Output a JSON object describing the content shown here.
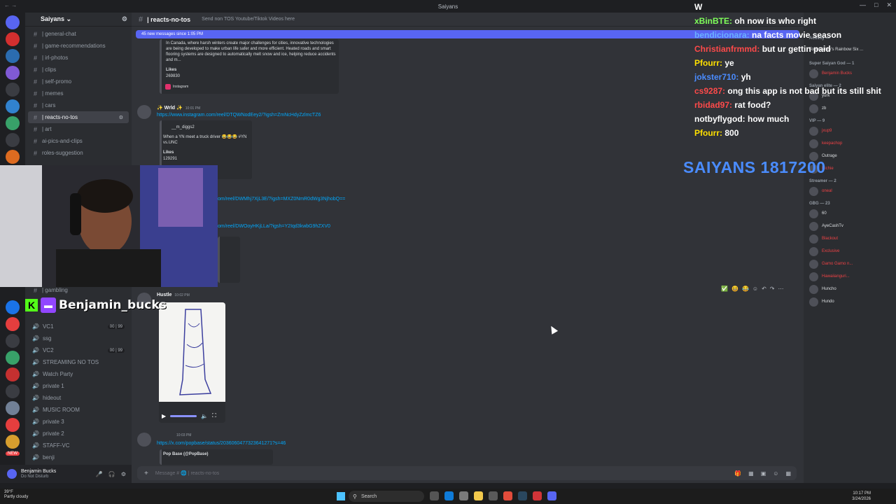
{
  "window": {
    "title": "Saiyans",
    "left": "← →"
  },
  "guild": {
    "name": "Saiyans ⌄"
  },
  "channels": [
    {
      "label": "| general-chat"
    },
    {
      "label": "| game-recommendations"
    },
    {
      "label": "| irl-photos"
    },
    {
      "label": "| clips"
    },
    {
      "label": "| self-promo"
    },
    {
      "label": "| memes"
    },
    {
      "label": "| cars"
    },
    {
      "label": "| reacts-no-tos",
      "active": true
    },
    {
      "label": "| art"
    },
    {
      "label": "ai-pics-and-clips"
    },
    {
      "label": "roles-suggestion"
    }
  ],
  "channels_lower": {
    "gambling": "| gambling"
  },
  "voice": [
    {
      "label": "VC1",
      "count": "00 | 99"
    },
    {
      "label": "ssg"
    },
    {
      "label": "VC2",
      "count": "00 | 99"
    },
    {
      "label": "STREAMING NO TOS"
    },
    {
      "label": "Watch Party"
    },
    {
      "label": "private 1"
    },
    {
      "label": "hideout"
    },
    {
      "label": "MUSIC ROOM"
    },
    {
      "label": "private 3"
    },
    {
      "label": "private 2"
    },
    {
      "label": "STAFF-VC"
    },
    {
      "label": "benji"
    }
  ],
  "user": {
    "name": "Benjamin Bucks",
    "status": "Do Not Disturb",
    "new_badge": "NEW"
  },
  "header": {
    "channel": "| reacts-no-tos",
    "topic": "Send non TOS Youtube/Tiktok Videos here"
  },
  "newbar": "45 new messages since 1:05 PM",
  "embed1": {
    "text": "In Canada, where harsh winters create major challenges for cities, innovative technologies are being developed to make urban life safer and more efficient. Heated roads and smart flooring systems are designed to automatically melt snow and ice, helping reduce accidents and m...",
    "likes_label": "Likes",
    "likes": "269830",
    "source": "Instagram"
  },
  "msg2": {
    "author": "✨ Wrld ✨",
    "time": "10:01 PM",
    "link": "https://www.instagram.com/reel/DTQWNodEey2/?igsh=ZmNcHdyZzlmcTZ6",
    "embed_author": "__m_diggs2",
    "embed_text": "When a YN meet a truck driver 😂😂😂 #YN vs.UNC",
    "likes_label": "Likes",
    "likes": "129291"
  },
  "links": {
    "l1": "om/reel/DWMhj7XjL3E/?igsh=MXZ0NmR0dWg3NjhobQ==",
    "l2": "om/reel/DWOoyHKjLLa/?igsh=Y2Iqd3kwbG9hZXV0"
  },
  "msg3": {
    "author": "Hustle",
    "time": "10:02 PM"
  },
  "msg4": {
    "time": "10:03 PM",
    "link": "https://x.com/popbase/status/2036060477323641271?s=46",
    "embed_author": "Pop Base (@PopBase)"
  },
  "composer": {
    "placeholder": "Message # 🌐 | reacts-no-tos"
  },
  "members": {
    "activity": "Activity —",
    "game": "Tom Clancy's Rainbow Six ...",
    "group1": "Super Saiyan God — 1",
    "member1": "Benjamin Bucks",
    "group2": "Saiyan elite — 2",
    "m_yurk": "yurk",
    "m_zb": "zb",
    "group3": "VIP — 9",
    "m_jxup": "jxup9",
    "m_keep": "keepachop",
    "m_outrage": "Outrage",
    "m_richie": "Richie",
    "group4": "Streamer — 2",
    "m_oneal": "oneal",
    "group5": "GBG — 23",
    "m_60": "60",
    "m_ayecash": "AyeCashTv",
    "m_blackout": "Blackout",
    "m_exclusive": "Exclusive",
    "m_gamo": "Gamo Gamo n...",
    "m_hawaiian": "Hawaiianguri...",
    "m_huncho": "Huncho",
    "m_hundo": "Hundo"
  },
  "overlay_chat": [
    {
      "user": "W",
      "color": "#ffffff",
      "msg": ""
    },
    {
      "user": "xBinBTE:",
      "color": "#7fff5a",
      "msg": "oh now its who right"
    },
    {
      "user": "bendicionara:",
      "color": "#6ab0ff",
      "msg": "na facts movie season"
    },
    {
      "user": "Christianfrmmd:",
      "color": "#ff4a4a",
      "msg": "but ur gettin paid"
    },
    {
      "user": "Pfourr:",
      "color": "#ffe000",
      "msg": "ye"
    },
    {
      "user": "jokster710:",
      "color": "#4a8cff",
      "msg": "yh"
    },
    {
      "user": "cs9287:",
      "color": "#ff4a4a",
      "msg": "ong this app is not bad but its still shit"
    },
    {
      "user": "rbidad97:",
      "color": "#ff4a4a",
      "msg": "rat food?"
    },
    {
      "user": "notbyflygod:",
      "color": "#ffffff",
      "msg": "how much"
    },
    {
      "user": "Pfourr:",
      "color": "#ffe000",
      "msg": "800"
    }
  ],
  "saiyans_count": "SAIYANS 1817200",
  "streamer": {
    "name": "Benjamin_bucks",
    "kick": "K"
  },
  "taskbar": {
    "weather_temp": "39°F",
    "weather_desc": "Partly cloudy",
    "search": "Search",
    "time": "10:17 PM",
    "date": "3/24/2026"
  }
}
